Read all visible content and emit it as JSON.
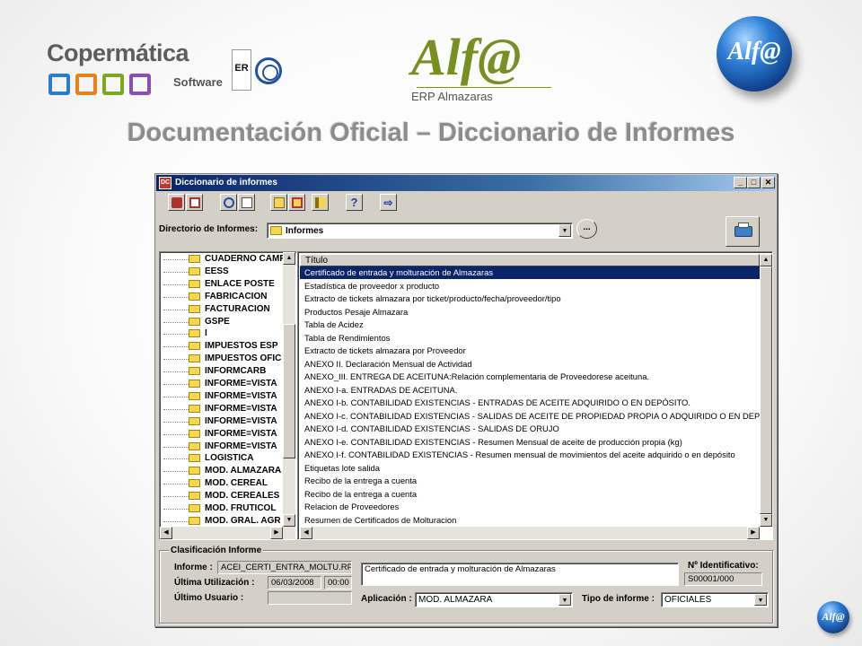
{
  "header": {
    "company_name": "Copermática",
    "company_sub": "Software",
    "company_squares": [
      "#2b7bd1",
      "#e8821e",
      "#7da822",
      "#8a4fb3"
    ],
    "cert_label": "ER",
    "product_logo": "Alf@",
    "product_sub": "ERP Almazaras",
    "ball_logo": "Alf@",
    "page_title": "Documentación Oficial – Diccionario de Informes"
  },
  "window": {
    "title": "Diccionario de informes",
    "app_icon_text": "DC",
    "controls": {
      "minimize": "_",
      "maximize": "□",
      "close": "✕"
    },
    "toolbar": [
      {
        "name": "report-design-icon",
        "color": "#b03030"
      },
      {
        "name": "report-edit-icon",
        "color": "#b03030"
      },
      {
        "name": "search-icon",
        "color": "#1d4fa0"
      },
      {
        "name": "preview-icon",
        "color": "#555555"
      },
      {
        "name": "copy-icon",
        "color": "#c9a316"
      },
      {
        "name": "delete-icon",
        "color": "#c03030"
      },
      {
        "name": "sort-icon",
        "color": "#c9a316"
      },
      {
        "name": "help-icon",
        "color": "#1d3fa0"
      },
      {
        "name": "exit-icon",
        "color": "#1d3fa0"
      }
    ],
    "directory": {
      "label": "Directorio de Informes:",
      "value": "Informes",
      "browse_label": "..."
    },
    "tree_items": [
      "CUADERNO CAMPO",
      "EESS",
      "ENLACE POSTE",
      "FABRICACION",
      "FACTURACION",
      "GSPE",
      "I",
      "IMPUESTOS ESP",
      "IMPUESTOS OFIC",
      "INFORMCARB",
      "INFORME=VISTA",
      "INFORME=VISTA",
      "INFORME=VISTA",
      "INFORME=VISTA",
      "INFORME=VISTA",
      "INFORME=VISTA",
      "LOGISTICA",
      "MOD. ALMAZARA",
      "MOD. CEREAL",
      "MOD. CEREALES",
      "MOD. FRUTICOL",
      "MOD. GRAL. AGR"
    ],
    "list": {
      "header": "Título",
      "selected_index": 0,
      "items": [
        "Certificado de entrada y molturación de Almazaras",
        "Estadística de proveedor x producto",
        "Extracto de tickets almazara por ticket/producto/fecha/proveedor/tipo",
        "Productos Pesaje Almazara",
        "Tabla de Acidez",
        "Tabla de Rendimientos",
        "Extracto de tickets almazara por Proveedor",
        "ANEXO II. Declaración Mensual de Actividad",
        "ANEXO_III. ENTREGA DE ACEITUNA:Relación complementaria de Proveedorese aceituna.",
        "ANEXO I-a. ENTRADAS DE ACEITUNA.",
        "ANEXO I-b. CONTABILIDAD EXISTENCIAS - ENTRADAS DE ACEITE ADQUIRIDO O EN DEPÓSITO.",
        "ANEXO I-c. CONTABILIDAD EXISTENCIAS - SALIDAS DE ACEITE DE PROPIEDAD PROPIA O ADQUIRIDO O EN DEP...",
        "ANEXO I-d. CONTABILIDAD EXISTENCIAS - SALIDAS DE ORUJO",
        "ANEXO I-e. CONTABILIDAD EXISTENCIAS - Resumen Mensual de aceite de producción propia (kg)",
        "ANEXO I-f. CONTABILIDAD EXISTENCIAS - Resumen mensual de movimientos del aceite adquirido o en depósito",
        "Etiquetas lote salida",
        "Recibo de la entrega a cuenta",
        "Recibo de la entrega a cuenta",
        "Relacion de Proveedores",
        "Resumen de Certificados de Molturacion"
      ]
    },
    "classification": {
      "title": "Clasificación Informe",
      "informe_label": "Informe :",
      "informe_value": "ACEI_CERTI_ENTRA_MOLTU.RP",
      "description": "Certificado de entrada y molturación de Almazaras",
      "id_label": "Nº Identificativo:",
      "id_value": "S00001/000",
      "last_use_label": "Última Utilización :",
      "last_use_date": "06/03/2008",
      "last_use_time": "00:00",
      "last_user_label": "Último Usuario :",
      "last_user_value": "",
      "app_label": "Aplicación :",
      "app_value": "MOD. ALMAZARA",
      "type_label": "Tipo de informe :",
      "type_value": "OFICIALES"
    }
  },
  "corner_logo": "Alf@"
}
